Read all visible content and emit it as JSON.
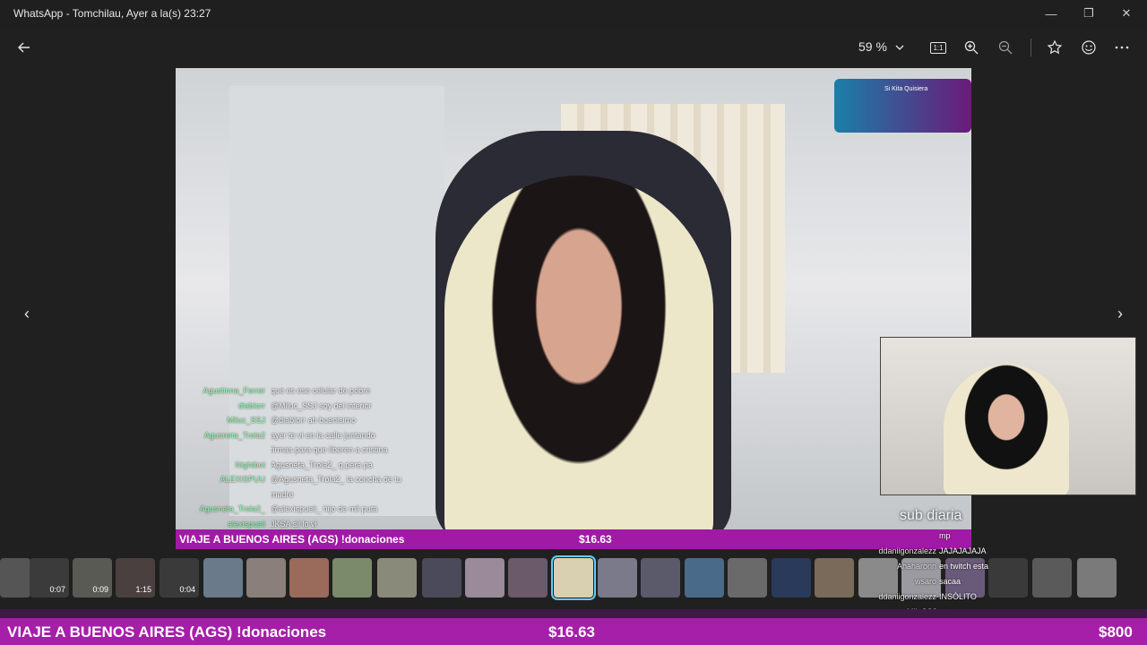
{
  "window": {
    "title": "WhatsApp - Tomchilau, Ayer a la(s) 23:27",
    "minimize_glyph": "—",
    "maximize_glyph": "❐",
    "close_glyph": "✕"
  },
  "toolbar": {
    "back_icon": "arrow-left-icon",
    "zoom_level": "59 %",
    "zoom_dropdown_icon": "chevron-down-icon",
    "actual_size_label": "1:1",
    "zoom_in_icon": "zoom-in-icon",
    "zoom_out_icon": "zoom-out-icon",
    "favorite_icon": "star-icon",
    "emoji_icon": "smiley-icon",
    "more_icon": "more-icon"
  },
  "image": {
    "stream_chat": [
      {
        "user": "Agustinna_Ferrer",
        "msg": "que es ese celular de pobre"
      },
      {
        "user": "diablorr",
        "msg": "@Miluc_SSJ soy del interior"
      },
      {
        "user": "Miluc_SSJ",
        "msg": "@diablorr ah buenisimo"
      },
      {
        "user": "Agusneta_Trola2",
        "msg": "ayer te vi en la calle juntando"
      },
      {
        "user": "",
        "msg": "firmas para que liberen a cristina"
      },
      {
        "user": "Nightbot",
        "msg": "Agusneta_Trola2_ q pera pa"
      },
      {
        "user": "ALEXISPUU",
        "msg": "@Agusneta_Trola2_ la concha de tu"
      },
      {
        "user": "",
        "msg": "madre"
      },
      {
        "user": "Agusneta_Trola2_",
        "msg": "@alexispueii_ hijo de mil puta"
      },
      {
        "user": "alexispueii",
        "msg": "JKSA sii lo vi"
      }
    ],
    "overlay_title": "Si Kita Quisiera",
    "caption_text": "sub diaria",
    "banner_title": "VIAJE A BUENOS AIRES (AGS) !donaciones",
    "banner_amount": "$16.63"
  },
  "nav": {
    "prev_glyph": "‹",
    "next_glyph": "›"
  },
  "filmstrip": {
    "thumbs": [
      {
        "duration": ""
      },
      {
        "duration": "0:07"
      },
      {
        "duration": "0:09"
      },
      {
        "duration": "1:15"
      },
      {
        "duration": "0:04"
      },
      {
        "duration": ""
      },
      {
        "duration": ""
      },
      {
        "duration": ""
      },
      {
        "duration": ""
      },
      {
        "duration": ""
      },
      {
        "duration": ""
      },
      {
        "duration": ""
      },
      {
        "duration": ""
      },
      {
        "duration": ""
      },
      {
        "duration": ""
      },
      {
        "duration": ""
      },
      {
        "duration": ""
      },
      {
        "duration": ""
      },
      {
        "duration": ""
      },
      {
        "duration": ""
      },
      {
        "duration": ""
      },
      {
        "duration": ""
      },
      {
        "duration": ""
      },
      {
        "duration": ""
      },
      {
        "duration": ""
      },
      {
        "duration": ""
      },
      {
        "duration": ""
      },
      {
        "duration": ""
      }
    ],
    "selected_index": 13
  },
  "overlay_chat": [
    {
      "user": "",
      "msg": "mp"
    },
    {
      "user": "ddaniigonzalezz",
      "msg": "JAJAJAJAJA"
    },
    {
      "user": "Ahaharonn",
      "msg": "en twitch esta"
    },
    {
      "user": "wsaro",
      "msg": "sacaa"
    },
    {
      "user": "ddaniigonzalezz",
      "msg": "INSÓLITO"
    },
    {
      "user": "MiluSSJ",
      "msg": "raro"
    }
  ],
  "bottom_banner": {
    "title": "VIAJE A BUENOS AIRES (AGS) !donaciones",
    "amount": "$16.63",
    "goal": "$800"
  },
  "colors": {
    "accent": "#60cdff",
    "banner": "#a51fa8"
  }
}
